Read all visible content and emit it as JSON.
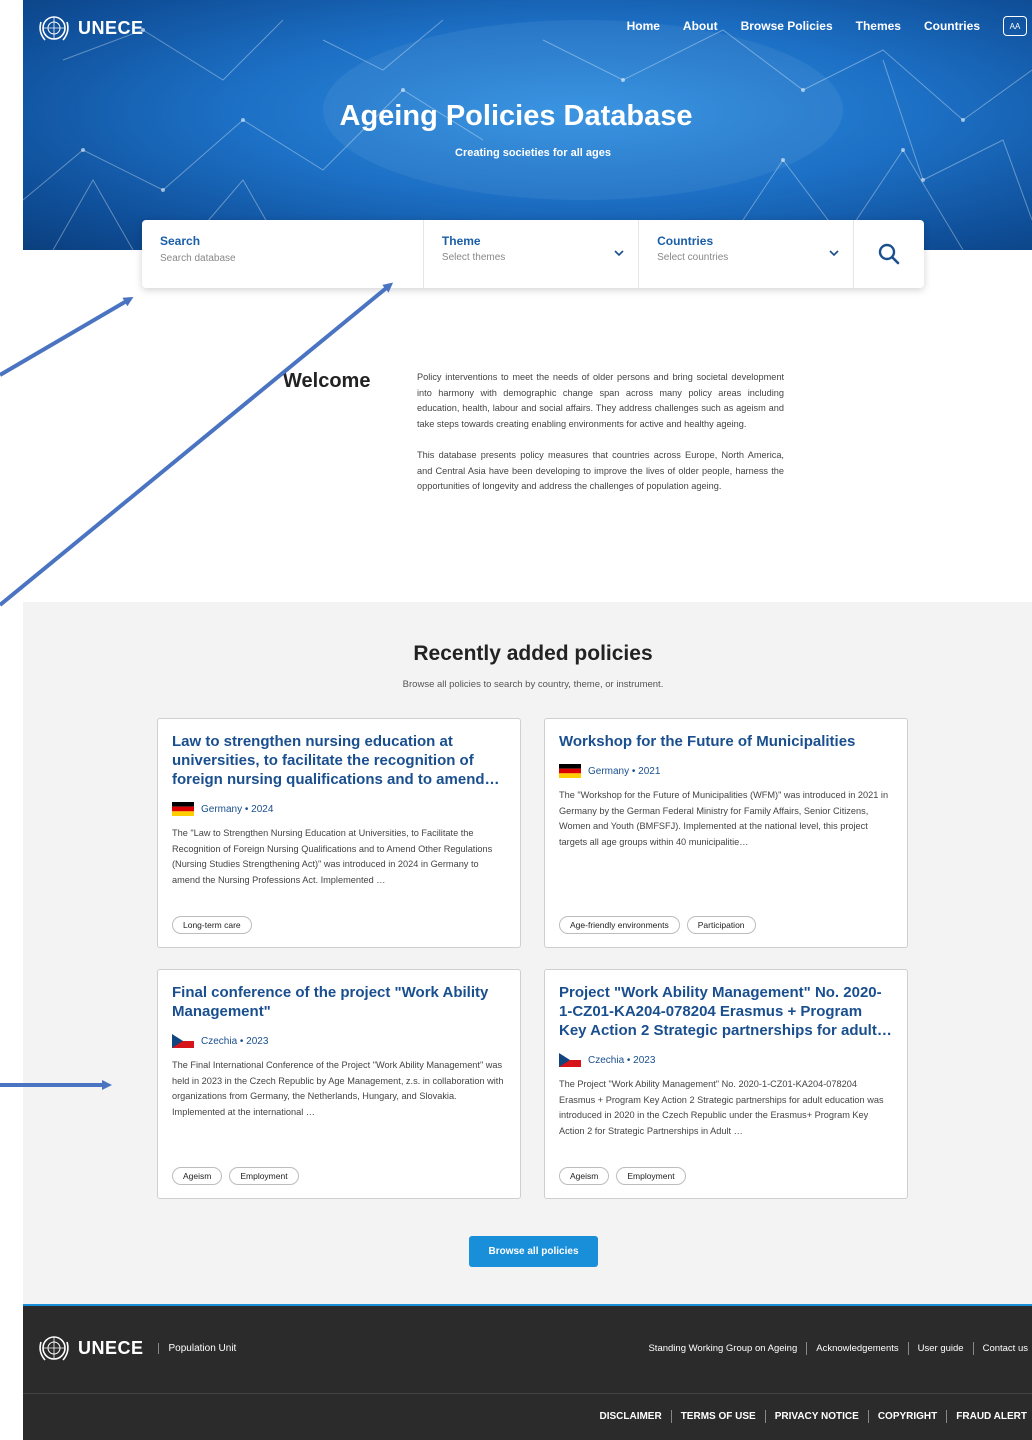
{
  "header": {
    "logo_text": "UNECE",
    "nav": [
      "Home",
      "About",
      "Browse Policies",
      "Themes",
      "Countries"
    ],
    "text_size_label": "AA"
  },
  "hero": {
    "title": "Ageing Policies Database",
    "subtitle": "Creating societies for all ages"
  },
  "search": {
    "search_label": "Search",
    "search_placeholder": "Search database",
    "theme_label": "Theme",
    "theme_placeholder": "Select themes",
    "countries_label": "Countries",
    "countries_placeholder": "Select countries"
  },
  "welcome": {
    "title": "Welcome",
    "paragraphs": [
      "Policy interventions to meet the needs of older persons and bring societal development into harmony with demographic change span across many policy areas including education, health, labour and social affairs. They address challenges such as ageism and take steps towards creating enabling environments for active and healthy ageing.",
      "This database presents policy measures that countries across Europe, North America, and Central Asia have been developing to improve the lives of older people, harness the opportunities of longevity and address the challenges of population ageing."
    ]
  },
  "recent": {
    "title": "Recently added policies",
    "subtitle": "Browse all policies to search by country, theme, or instrument.",
    "cards": [
      {
        "title": "Law to strengthen nursing education at universities, to facilitate the recognition of foreign nursing qualifications and to amend…",
        "meta": "Germany • 2024",
        "flag": "germany-flag",
        "desc": "The \"Law to Strengthen Nursing Education at Universities, to Facilitate the Recognition of Foreign Nursing Qualifications and to Amend Other Regulations (Nursing Studies Strengthening Act)\" was introduced in 2024 in Germany to amend the Nursing Professions Act. Implemented …",
        "tags": [
          "Long-term care"
        ]
      },
      {
        "title": "Workshop for the Future of Municipalities",
        "meta": "Germany • 2021",
        "flag": "germany-flag",
        "desc": "The \"Workshop for the Future of Municipalities (WFM)\" was introduced in 2021 in Germany by the German Federal Ministry for Family Affairs, Senior Citizens, Women and Youth (BMFSFJ). Implemented at the national level, this project targets all age groups within 40 municipalitie…",
        "tags": [
          "Age-friendly environments",
          "Participation"
        ]
      },
      {
        "title": "Final conference of the project \"Work Ability Management\"",
        "meta": "Czechia • 2023",
        "flag": "czechia-flag",
        "desc": "The Final International Conference of the Project \"Work Ability Management\" was held in 2023 in the Czech Republic by Age Management, z.s. in collaboration with organizations from Germany, the Netherlands, Hungary, and Slovakia. Implemented at the international …",
        "tags": [
          "Ageism",
          "Employment"
        ]
      },
      {
        "title": "Project \"Work Ability Management\" No. 2020-1-CZ01-KA204-078204 Erasmus + Program Key Action 2 Strategic partnerships for adult…",
        "meta": "Czechia • 2023",
        "flag": "czechia-flag",
        "desc": "The Project \"Work Ability Management\" No. 2020-1-CZ01-KA204-078204 Erasmus + Program Key Action 2 Strategic partnerships for adult education was introduced in 2020 in the Czech Republic under the Erasmus+ Program Key Action 2 for Strategic Partnerships in Adult …",
        "tags": [
          "Ageism",
          "Employment"
        ]
      }
    ],
    "browse_button": "Browse all policies"
  },
  "footer": {
    "logo_text": "UNECE",
    "unit": "Population Unit",
    "links": [
      "Standing Working Group on Ageing",
      "Acknowledgements",
      "User guide",
      "Contact us"
    ],
    "legal": [
      "DISCLAIMER",
      "TERMS OF USE",
      "PRIVACY NOTICE",
      "COPYRIGHT",
      "FRAUD ALERT"
    ]
  },
  "colors": {
    "brand_blue": "#1a4f8f",
    "accent": "#1a8fd9",
    "footer_bg": "#2b2b2b",
    "annotation_arrow": "#4a74c2"
  }
}
